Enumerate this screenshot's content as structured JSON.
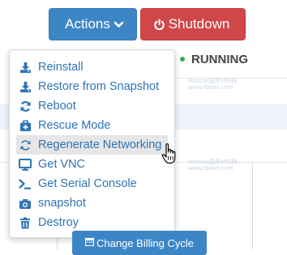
{
  "header": {
    "actions_label": "Actions",
    "shutdown_label": "Shutdown"
  },
  "status": {
    "label": "RUNNING",
    "color": "#3ea94d"
  },
  "menu": {
    "items": [
      {
        "label": "Reinstall",
        "icon": "download-icon"
      },
      {
        "label": "Restore from Snapshot",
        "icon": "download-icon"
      },
      {
        "label": "Reboot",
        "icon": "refresh-icon"
      },
      {
        "label": "Rescue Mode",
        "icon": "medkit-icon"
      },
      {
        "label": "Regenerate Networking",
        "icon": "exchange-icon",
        "hovered": true
      },
      {
        "label": "Get VNC",
        "icon": "monitor-icon"
      },
      {
        "label": "Get Serial Console",
        "icon": "terminal-icon"
      },
      {
        "label": "snapshot",
        "icon": "camera-icon"
      },
      {
        "label": "Destroy",
        "icon": "trash-icon"
      }
    ]
  },
  "footer": {
    "billing_label": "Change Billing Cycle"
  },
  "watermark": {
    "text": "Hostloc国外VPS网",
    "url": "www.fbdae.com"
  },
  "colors": {
    "accent": "#3d86c6",
    "danger": "#d0474a",
    "link": "#2f74b5"
  }
}
